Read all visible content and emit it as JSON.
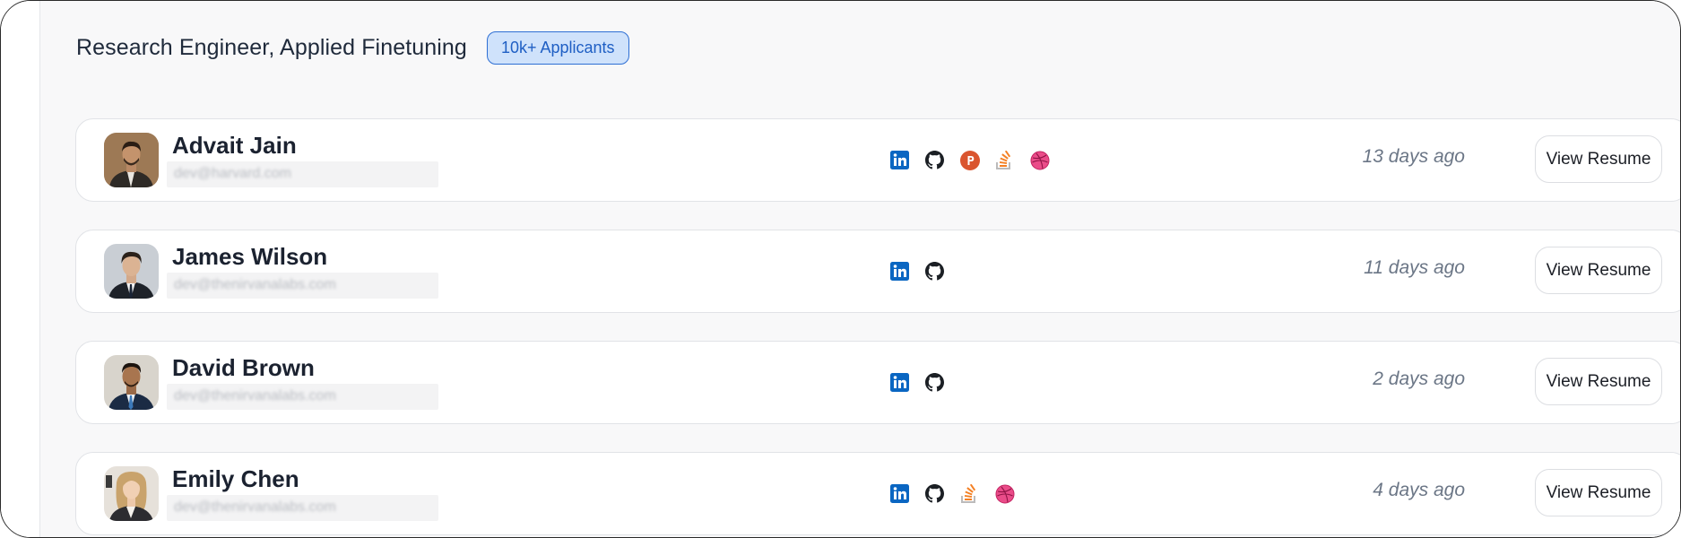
{
  "header": {
    "title": "Research Engineer, Applied Finetuning",
    "applicant_badge": "10k+ Applicants"
  },
  "candidates": [
    {
      "name": "Advait Jain",
      "email": "dev@harvard.com",
      "applied": "13 days ago",
      "view_label": "View Resume",
      "profiles": [
        "linkedin-icon",
        "github-icon",
        "producthunt-icon",
        "stackoverflow-icon",
        "dribbble-icon"
      ]
    },
    {
      "name": "James Wilson",
      "email": "dev@thenirvanalabs.com",
      "applied": "11 days ago",
      "view_label": "View Resume",
      "profiles": [
        "linkedin-icon",
        "github-icon"
      ]
    },
    {
      "name": "David Brown",
      "email": "dev@thenirvanalabs.com",
      "applied": "2 days ago",
      "view_label": "View Resume",
      "profiles": [
        "linkedin-icon",
        "github-icon"
      ]
    },
    {
      "name": "Emily Chen",
      "email": "dev@thenirvanalabs.com",
      "applied": "4 days ago",
      "view_label": "View Resume",
      "profiles": [
        "linkedin-icon",
        "github-icon",
        "stackoverflow-icon",
        "dribbble-icon"
      ]
    }
  ],
  "colors": {
    "badge_bg": "#cfe2fb",
    "badge_border": "#2e6fd4",
    "linkedin": "#0a66c2",
    "producthunt": "#da552f",
    "stackoverflow": "#f48024",
    "dribbble": "#ea4c89"
  }
}
